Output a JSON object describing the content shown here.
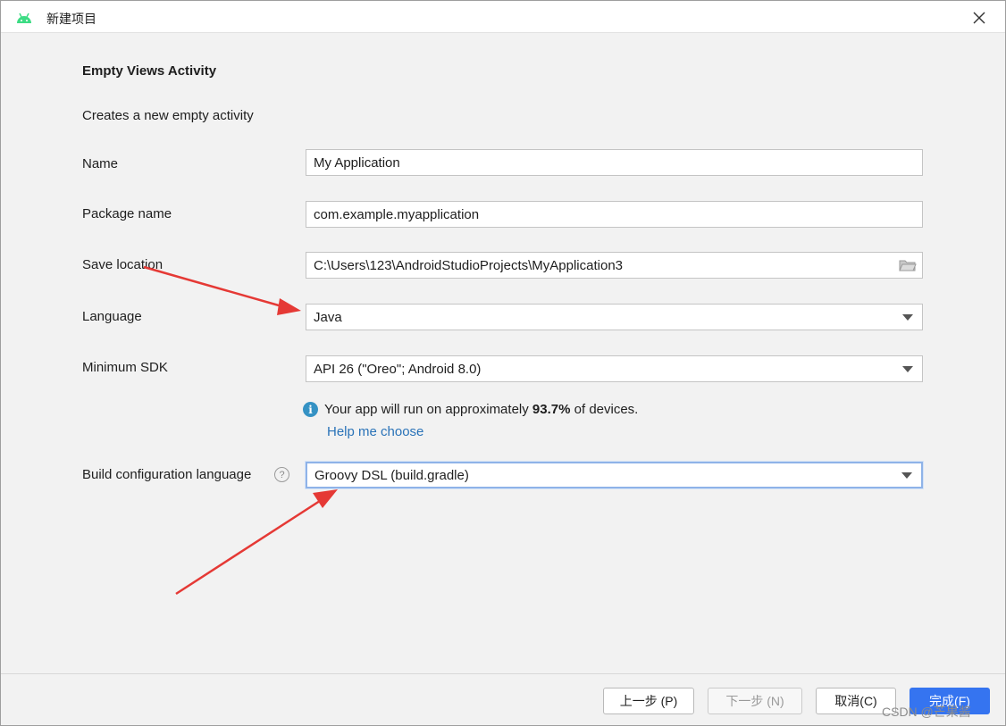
{
  "window": {
    "title": "新建项目",
    "close_symbol": "✕"
  },
  "form": {
    "heading": "Empty Views Activity",
    "description": "Creates a new empty activity",
    "name_label": "Name",
    "name_value": "My Application",
    "package_label": "Package name",
    "package_value": "com.example.myapplication",
    "save_label": "Save location",
    "save_value": "C:\\Users\\123\\AndroidStudioProjects\\MyApplication3",
    "language_label": "Language",
    "language_value": "Java",
    "sdk_label": "Minimum SDK",
    "sdk_value": "API 26 (\"Oreo\"; Android 8.0)",
    "info_prefix": "Your app will run on approximately",
    "info_percent": "93.7%",
    "info_suffix": "of devices.",
    "help_link": "Help me choose",
    "build_label": "Build configuration language",
    "build_value": "Groovy DSL (build.gradle)"
  },
  "buttons": {
    "previous": "上一步 (P)",
    "next": "下一步 (N)",
    "cancel": "取消(C)",
    "finish": "完成(F)"
  },
  "watermark": "CSDN @芒果酱",
  "colors": {
    "accent": "#3574f0",
    "link": "#2a73b8",
    "annotation_arrow": "#e53935",
    "android_green": "#3ddc84"
  },
  "icons": [
    "android-icon",
    "close-icon",
    "folder-icon",
    "chevron-down-icon",
    "info-icon",
    "help-question-icon",
    "annotation-arrow"
  ]
}
